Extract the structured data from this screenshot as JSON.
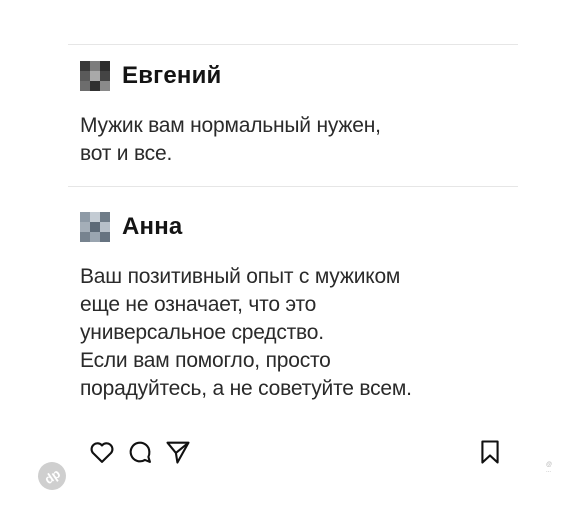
{
  "comments": [
    {
      "author": "Евгений",
      "lines": [
        "Мужик вам нормальный нужен,",
        "вот и все."
      ]
    },
    {
      "author": "Анна",
      "lines": [
        "Ваш позитивный опыт с мужиком",
        "еще не означает, что это",
        "универсальное средство.",
        "Если вам помогло, просто",
        "порадуйтесь, а не советуйте всем."
      ]
    }
  ],
  "actions": {
    "like": "heart-icon",
    "comment": "comment-bubble-icon",
    "share": "send-icon",
    "save": "bookmark-icon"
  },
  "small_mark": "@ ...",
  "watermark": {
    "text": "dp",
    "icon": "watermark-logo"
  },
  "colors": {
    "text": "#2a2a2a",
    "divider": "#e6e6e6",
    "icon": "#111111"
  }
}
